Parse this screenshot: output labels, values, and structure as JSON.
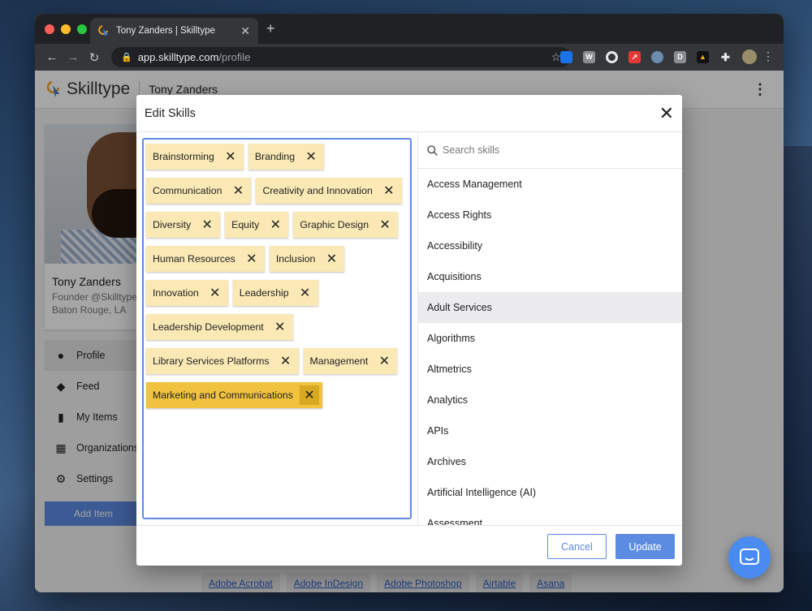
{
  "browser": {
    "tab_title": "Tony Zanders | Skilltype",
    "url_host": "app.skilltype.com",
    "url_path": "/profile",
    "traffic_lights": [
      "#ff5f57",
      "#febc2e",
      "#28c840"
    ]
  },
  "app": {
    "logo_text": "Skilltype",
    "header_user": "Tony Zanders",
    "accent": "#5c8be2"
  },
  "profile": {
    "name": "Tony Zanders",
    "title": "Founder @Skilltype",
    "location": "Baton Rouge, LA"
  },
  "side_nav": [
    {
      "label": "Profile",
      "icon": "person-icon",
      "active": true
    },
    {
      "label": "Feed",
      "icon": "graduation-cap-icon"
    },
    {
      "label": "My Items",
      "icon": "bookmark-icon"
    },
    {
      "label": "Organizations",
      "icon": "building-icon"
    },
    {
      "label": "Settings",
      "icon": "gear-icon"
    }
  ],
  "add_item_label": "Add Item",
  "tool_tags": [
    "Adobe Acrobat",
    "Adobe InDesign",
    "Adobe Photoshop",
    "Airtable",
    "Asana"
  ],
  "modal": {
    "title": "Edit Skills",
    "search_placeholder": "Search skills",
    "selected_skills": [
      "Brainstorming",
      "Branding",
      "Communication",
      "Creativity and Innovation",
      "Diversity",
      "Equity",
      "Graphic Design",
      "Human Resources",
      "Inclusion",
      "Innovation",
      "Leadership",
      "Leadership Development",
      "Library Services Platforms",
      "Management",
      "Marketing and Communications"
    ],
    "highlighted_skill": "Marketing and Communications",
    "skill_list": [
      "Access Management",
      "Access Rights",
      "Accessibility",
      "Acquisitions",
      "Adult Services",
      "Algorithms",
      "Altmetrics",
      "Analytics",
      "APIs",
      "Archives",
      "Artificial Intelligence (AI)",
      "Assessment"
    ],
    "hovered_skill": "Adult Services",
    "cancel_label": "Cancel",
    "update_label": "Update"
  }
}
